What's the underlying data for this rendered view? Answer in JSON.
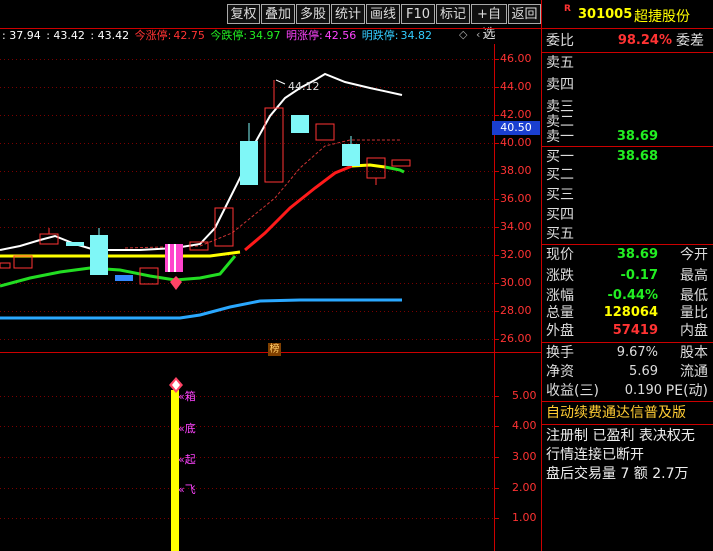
{
  "toolbar": {
    "buttons": [
      "复权",
      "叠加",
      "多股",
      "统计",
      "画线",
      "F10",
      "标记",
      "+自选",
      "返回"
    ]
  },
  "header": {
    "ma1": ": 37.94",
    "ma2": ": 43.42",
    "ma3": ": 43.42",
    "zt_label": "今涨停:",
    "zt_value": "42.75",
    "dt_label": "今跌停:",
    "dt_value": "34.97",
    "mzt_label": "明涨停:",
    "mzt_value": "42.56",
    "mdt_label": "明跌停:",
    "mdt_value": "34.82",
    "diamond": "◇",
    "arrows": "‹ ›"
  },
  "price_axis": {
    "ticks": [
      "46.00",
      "44.00",
      "42.00",
      "40.00",
      "38.00",
      "36.00",
      "34.00",
      "32.00",
      "30.00",
      "28.00",
      "26.00"
    ],
    "current_price_tag": "40.50"
  },
  "annotations": {
    "peak_label": "44.12",
    "bang_icon": "榜"
  },
  "indicator_axis": {
    "ticks": [
      "5.00",
      "4.00",
      "3.00",
      "2.00",
      "1.00"
    ]
  },
  "signal_labels": [
    "«箱",
    "«底",
    "«起",
    "«飞"
  ],
  "stock": {
    "badge": "R",
    "code": "301005",
    "name": "超捷股份"
  },
  "order_book": {
    "weibi_label": "委比",
    "weibi_value": "98.24%",
    "weicha_label": "委差",
    "sell": [
      {
        "label": "卖五",
        "price": ""
      },
      {
        "label": "卖四",
        "price": ""
      },
      {
        "label": "卖三",
        "price": ""
      },
      {
        "label": "卖二",
        "price": ""
      },
      {
        "label": "卖一",
        "price": "38.69"
      }
    ],
    "buy": [
      {
        "label": "买一",
        "price": "38.68"
      },
      {
        "label": "买二",
        "price": ""
      },
      {
        "label": "买三",
        "price": ""
      },
      {
        "label": "买四",
        "price": ""
      },
      {
        "label": "买五",
        "price": ""
      }
    ]
  },
  "quote": {
    "rows": [
      {
        "label": "现价",
        "value": "38.69",
        "label2": "今开",
        "color": "#22ee22"
      },
      {
        "label": "涨跌",
        "value": "-0.17",
        "label2": "最高",
        "color": "#22ee22"
      },
      {
        "label": "涨幅",
        "value": "-0.44%",
        "label2": "最低",
        "color": "#22ee22"
      },
      {
        "label": "总量",
        "value": "128064",
        "label2": "量比",
        "color": "#ffff00"
      },
      {
        "label": "外盘",
        "value": "57419",
        "label2": "内盘",
        "color": "#ff3333"
      }
    ],
    "finance": [
      {
        "label": "换手",
        "value": "9.67%",
        "label2": "股本"
      },
      {
        "label": "净资",
        "value": "5.69",
        "label2": "流通"
      },
      {
        "label": "收益(三)",
        "value": "0.190",
        "label2": "PE(动)"
      }
    ]
  },
  "info": {
    "link": "自动续费通达信普及版",
    "line1": "注册制 已盈利 表决权无",
    "line2": "行情连接已断开",
    "line3": "盘后交易量 7 额 2.7万"
  },
  "colors": {
    "up": "#ff3333",
    "down": "#22ee22",
    "accent": "#ffff00",
    "frame": "#cc0000"
  }
}
